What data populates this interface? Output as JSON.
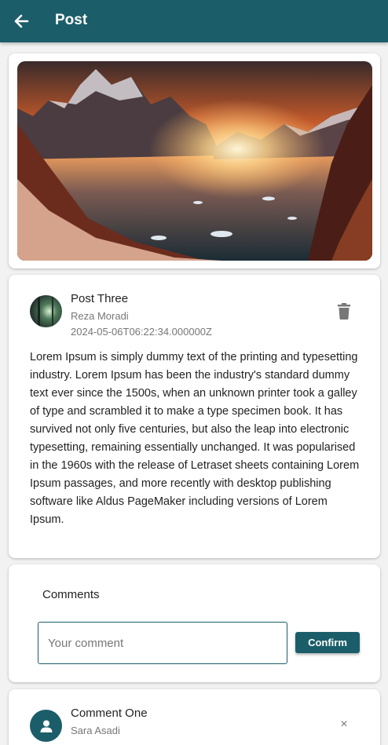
{
  "appbar": {
    "title": "Post",
    "back_icon": "arrow-left-icon",
    "background": "#1b5e6a"
  },
  "post": {
    "title": "Post Three",
    "author": "Reza Moradi",
    "date": "2024-05-06T06:22:34.000000Z",
    "body": "Lorem Ipsum is simply dummy text of the printing and typesetting industry. Lorem Ipsum has been the industry's standard dummy text ever since the 1500s, when an unknown printer took a galley of type and scrambled it to make a type specimen book. It has survived not only five centuries, but also the leap into electronic typesetting, remaining essentially unchanged. It was popularised in the 1960s with the release of Letraset sheets containing Lorem Ipsum passages, and more recently with desktop publishing software like Aldus PageMaker including versions of Lorem Ipsum.",
    "delete_icon": "trash-icon"
  },
  "comments": {
    "title": "Comments",
    "input_placeholder": "Your comment",
    "input_value": "",
    "confirm_label": "Confirm"
  },
  "comment_list": [
    {
      "title": "Comment One",
      "author": "Sara Asadi",
      "avatar_icon": "person-icon",
      "close_icon": "close-icon",
      "close_glyph": "×"
    }
  ]
}
